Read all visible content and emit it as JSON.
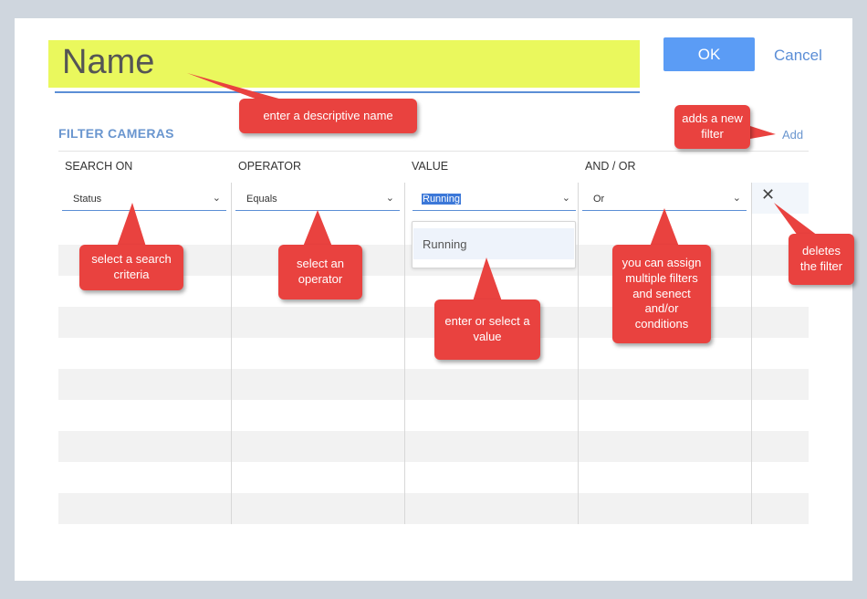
{
  "header": {
    "name_placeholder": "Name",
    "ok_label": "OK",
    "cancel_label": "Cancel"
  },
  "filters": {
    "title": "FILTER CAMERAS",
    "add_label": "Add",
    "columns": [
      "SEARCH ON",
      "OPERATOR",
      "VALUE",
      "AND / OR"
    ],
    "row": {
      "search_on": "Status",
      "operator": "Equals",
      "value": "Running",
      "and_or": "Or"
    },
    "value_options": [
      "Running"
    ],
    "delete_icon": "close-icon"
  },
  "callouts": {
    "name": "enter a descriptive name",
    "add": "adds a new filter",
    "search": "select a search criteria",
    "operator": "select an operator",
    "value": "enter or select a value",
    "andor": "you can assign multiple filters and senect and/or conditions",
    "delete": "deletes the filter"
  },
  "colors": {
    "accent": "#5b9cf5",
    "highlight": "#eaf85d",
    "callout": "#e9423f"
  }
}
